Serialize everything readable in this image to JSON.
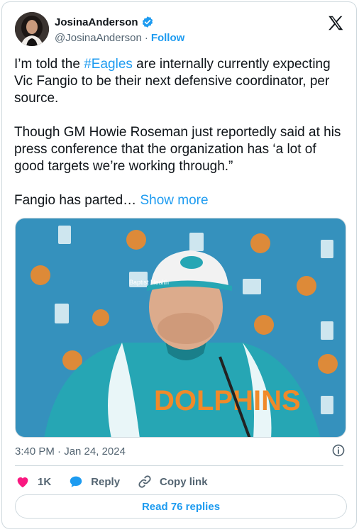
{
  "author": {
    "display_name": "JosinaAnderson",
    "handle": "@JosinaAnderson",
    "follow_label": "Follow",
    "separator": "·"
  },
  "tweet": {
    "text_part1": "I’m told the ",
    "hashtag": "#Eagles",
    "text_part2": " are internally currently expecting Vic Fangio to be their next defensive coordinator, per source.\n\nThough GM Howie Roseman just reportedly said at his press conference that the organization has ‘a lot of good targets we’re working through.”\n\nFangio has parted… ",
    "show_more": "Show more"
  },
  "media": {
    "jersey_text": "DOLPHINS",
    "backdrop_text": "Baptist Health"
  },
  "meta": {
    "timestamp": "3:40 PM · Jan 24, 2024"
  },
  "actions": {
    "like_count": "1K",
    "reply_label": "Reply",
    "copy_link_label": "Copy link"
  },
  "read_replies_label": "Read 76 replies",
  "colors": {
    "accent": "#1d9bf0",
    "like": "#f91880",
    "text": "#0f1419",
    "secondary": "#536471",
    "border": "#cfd9de",
    "dolphins_aqua": "#26a6b4"
  }
}
